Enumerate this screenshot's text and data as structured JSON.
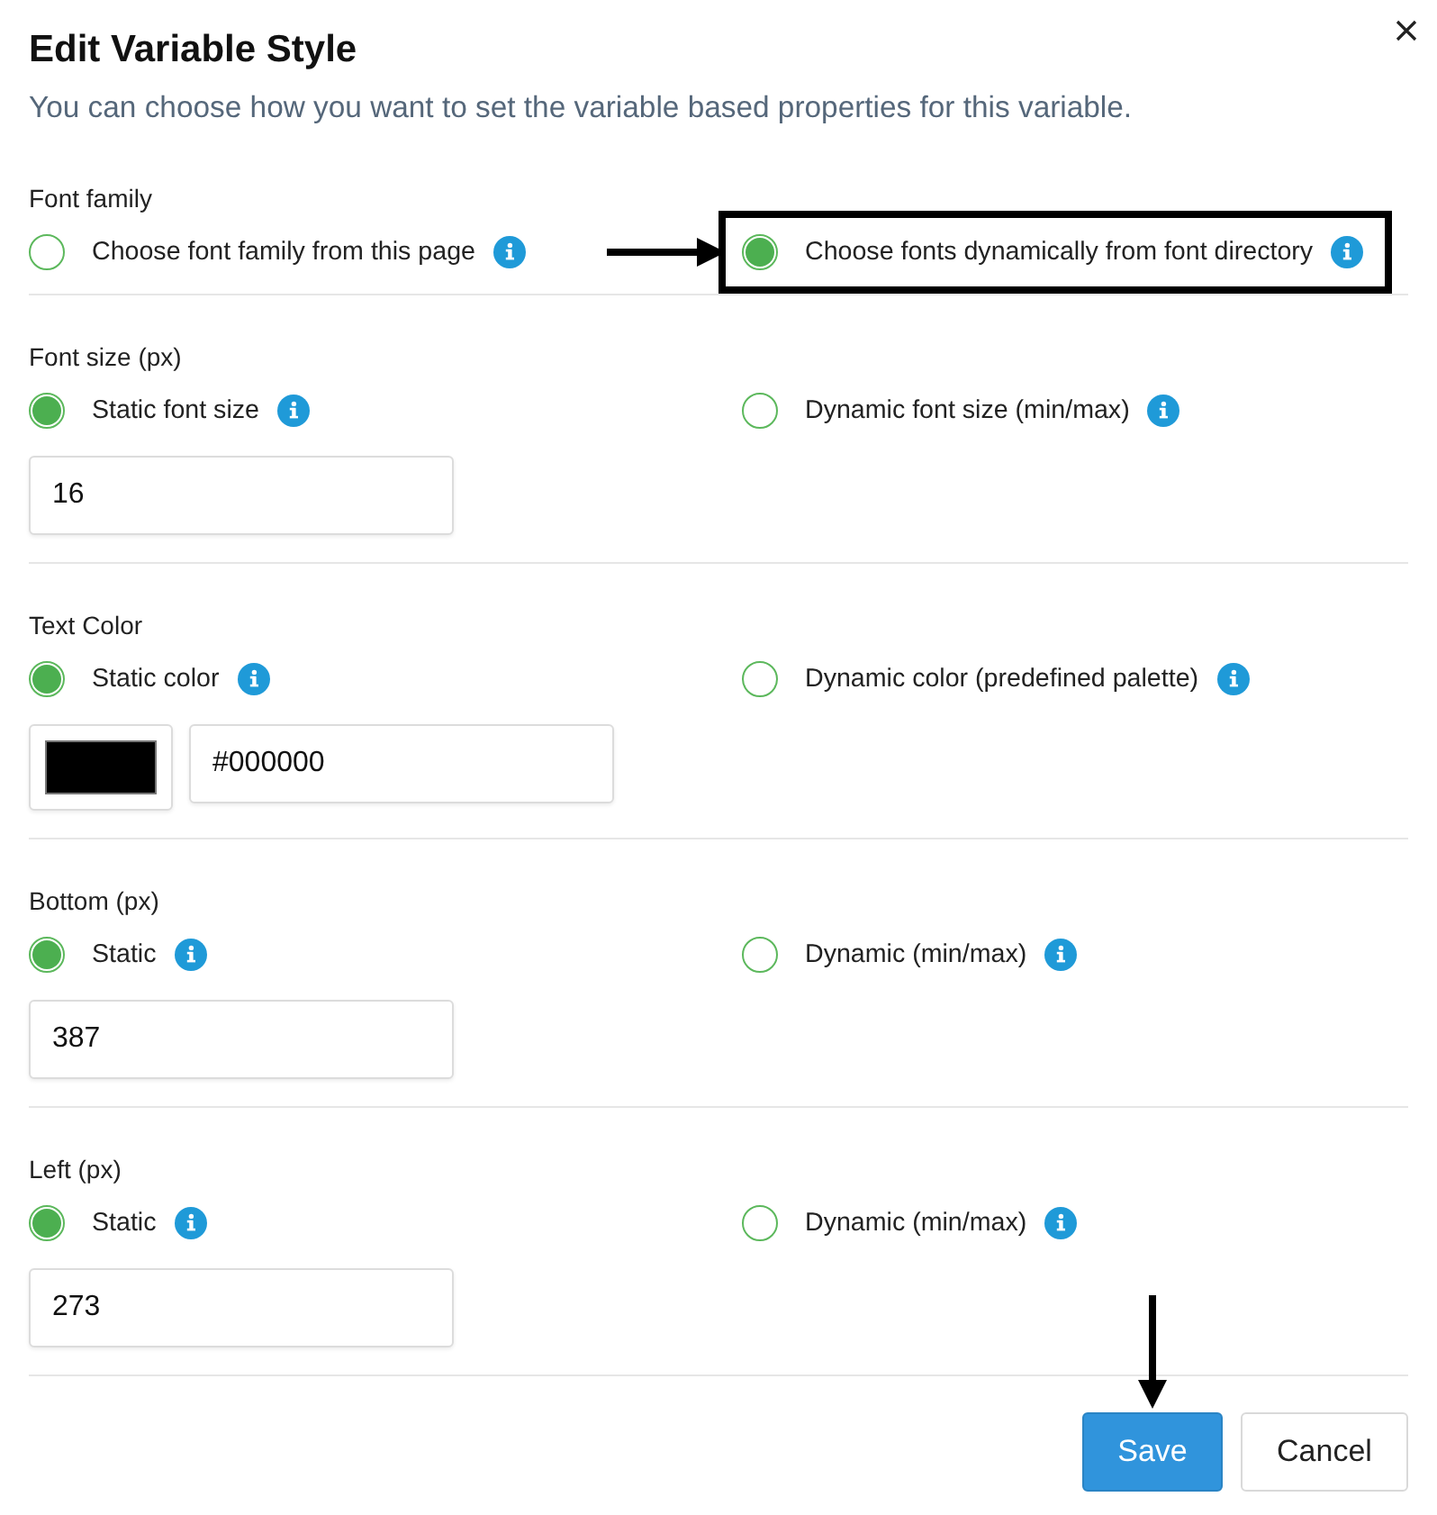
{
  "dialog": {
    "title": "Edit Variable Style",
    "subtitle": "You can choose how you want to set the variable based properties for this variable."
  },
  "sections": [
    {
      "label": "Font family",
      "options": [
        {
          "label": "Choose font family from this page",
          "selected": false,
          "highlighted": false
        },
        {
          "label": "Choose fonts dynamically from font directory",
          "selected": true,
          "highlighted": true
        }
      ]
    },
    {
      "label": "Font size (px)",
      "options": [
        {
          "label": "Static font size",
          "selected": true,
          "highlighted": false
        },
        {
          "label": "Dynamic font size (min/max)",
          "selected": false,
          "highlighted": false
        }
      ],
      "fields": [
        {
          "kind": "text",
          "value": "16"
        }
      ]
    },
    {
      "label": "Text Color",
      "options": [
        {
          "label": "Static color",
          "selected": true,
          "highlighted": false
        },
        {
          "label": "Dynamic color (predefined palette)",
          "selected": false,
          "highlighted": false
        }
      ],
      "fields": [
        {
          "kind": "swatch",
          "color": "#000000"
        },
        {
          "kind": "text",
          "value": "#000000"
        }
      ]
    },
    {
      "label": "Bottom (px)",
      "options": [
        {
          "label": "Static",
          "selected": true,
          "highlighted": false
        },
        {
          "label": "Dynamic (min/max)",
          "selected": false,
          "highlighted": false
        }
      ],
      "fields": [
        {
          "kind": "text",
          "value": "387"
        }
      ]
    },
    {
      "label": "Left (px)",
      "options": [
        {
          "label": "Static",
          "selected": true,
          "highlighted": false
        },
        {
          "label": "Dynamic (min/max)",
          "selected": false,
          "highlighted": false
        }
      ],
      "fields": [
        {
          "kind": "text",
          "value": "273"
        }
      ]
    }
  ],
  "buttons": [
    {
      "label": "Save",
      "kind": "primary",
      "highlighted": true
    },
    {
      "label": "Cancel",
      "kind": "secondary",
      "highlighted": false
    }
  ]
}
